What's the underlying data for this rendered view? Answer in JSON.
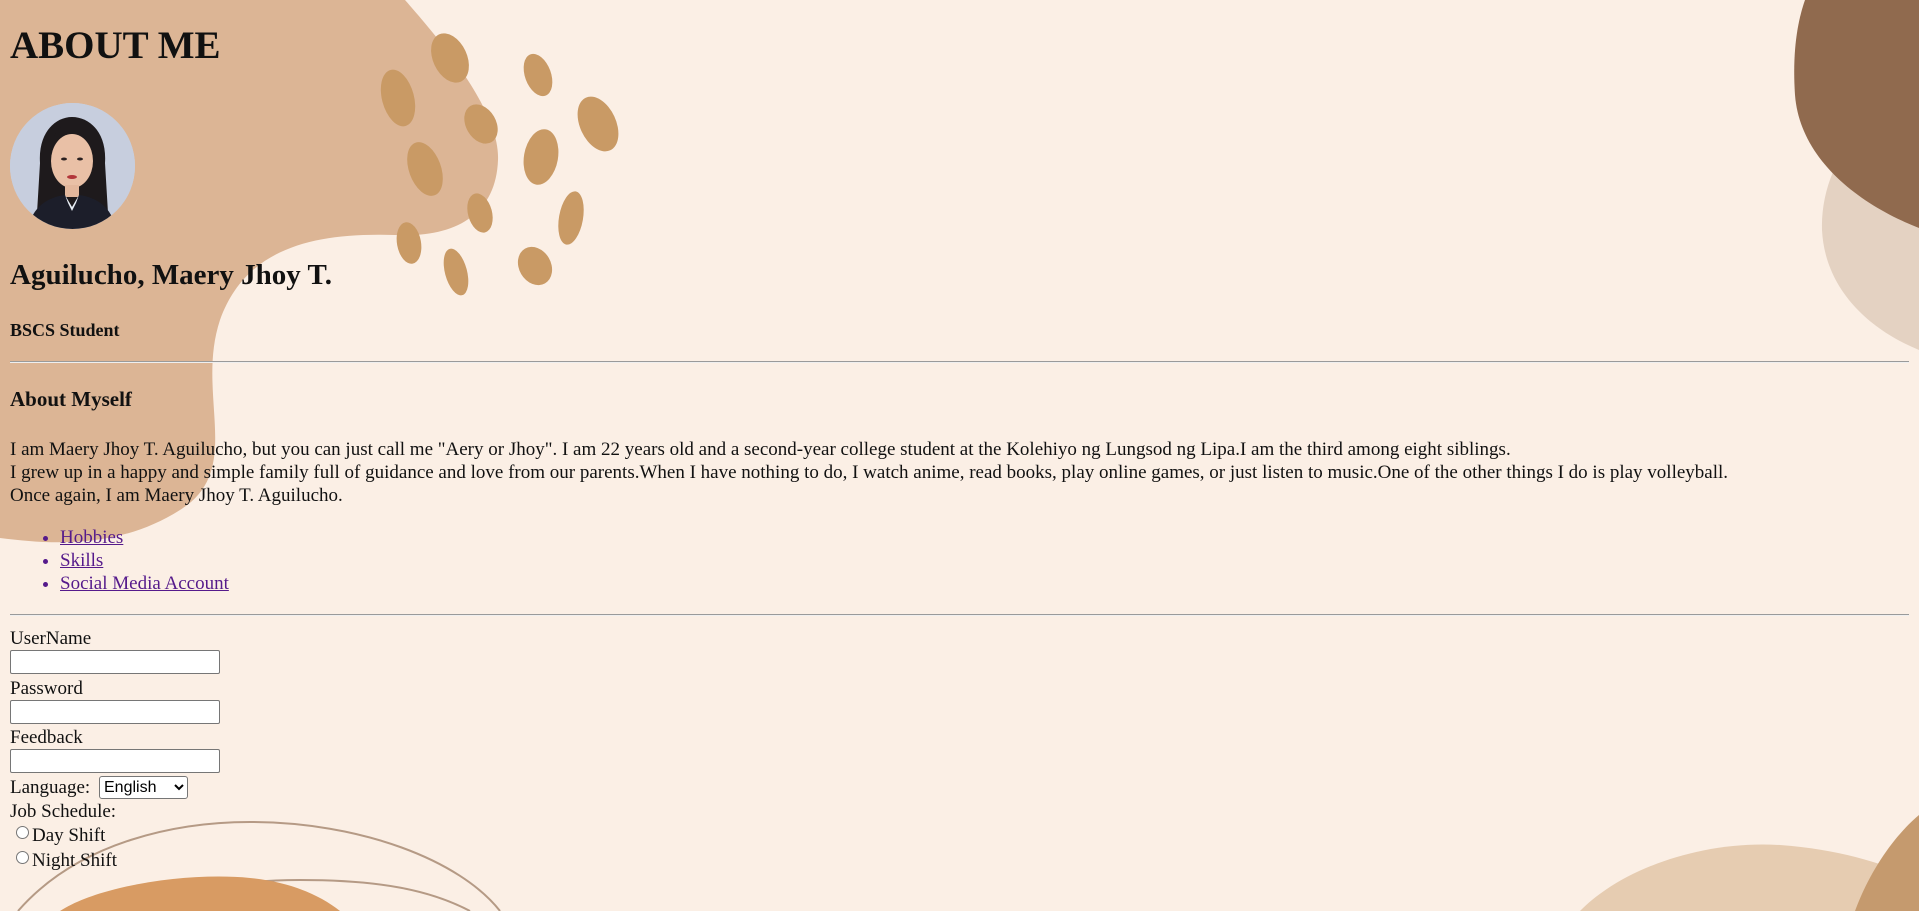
{
  "page": {
    "title": "ABOUT ME",
    "name": "Aguilucho, Maery Jhoy T.",
    "role": "BSCS Student"
  },
  "about": {
    "heading": "About Myself",
    "lines": [
      "I am Maery Jhoy T. Aguilucho, but you can just call me \"Aery or Jhoy\". I am 22 years old and a second-year college student at the Kolehiyo ng Lungsod ng Lipa.I am the third among eight siblings.",
      "I grew up in a happy and simple family full of guidance and love from our parents.When I have nothing to do, I watch anime, read books, play online games, or just listen to music.One of the other things I do is play volleyball.",
      "Once again, I am Maery Jhoy T. Aguilucho."
    ]
  },
  "links": [
    {
      "label": "Hobbies"
    },
    {
      "label": "Skills"
    },
    {
      "label": "Social Media Account"
    }
  ],
  "form": {
    "username_label": "UserName",
    "username_value": "",
    "password_label": "Password",
    "password_value": "",
    "feedback_label": "Feedback",
    "feedback_value": "",
    "language_label": "Language:",
    "language_value": "English",
    "schedule_label": "Job Schedule:",
    "schedule_options": [
      "Day Shift",
      "Night Shift"
    ]
  },
  "colors": {
    "background": "#fbefe5",
    "blob": "#dcb595",
    "leaf": "#c99a65",
    "dark_blob": "#906a4e",
    "light_blob": "#e4d2c2",
    "link": "#551a8b"
  }
}
